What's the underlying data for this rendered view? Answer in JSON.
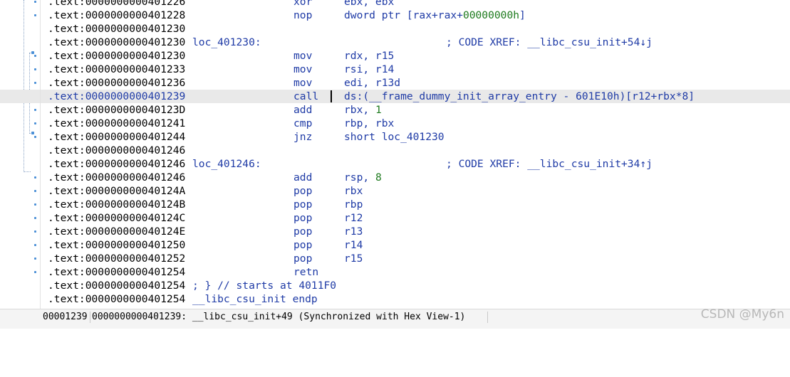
{
  "rows": [
    {
      "addr": ".text:0000000000401226",
      "label": "",
      "mnem": "xor",
      "op": "ebx, ebx",
      "comment": ""
    },
    {
      "addr": ".text:0000000000401228",
      "label": "",
      "mnem": "nop",
      "op": "dword ptr [rax+rax+",
      "op_num": "00000000h",
      "op_tail": "]",
      "comment": ""
    },
    {
      "addr": ".text:0000000000401230",
      "label": "",
      "mnem": "",
      "op": "",
      "comment": ""
    },
    {
      "addr": ".text:0000000000401230",
      "label": "loc_401230:",
      "mnem": "",
      "op": "",
      "comment": "; CODE XREF: __libc_csu_init+54↓j"
    },
    {
      "addr": ".text:0000000000401230",
      "label": "",
      "mnem": "mov",
      "op": "rdx, r15",
      "comment": ""
    },
    {
      "addr": ".text:0000000000401233",
      "label": "",
      "mnem": "mov",
      "op": "rsi, r14",
      "comment": ""
    },
    {
      "addr": ".text:0000000000401236",
      "label": "",
      "mnem": "mov",
      "op": "edi, r13d",
      "comment": ""
    },
    {
      "addr": ".text:0000000000401239",
      "label": "",
      "mnem": "call",
      "op": "ds:(__frame_dummy_init_array_entry - 601E10h)[r12+rbx*8]",
      "comment": "",
      "current": true
    },
    {
      "addr": ".text:000000000040123D",
      "label": "",
      "mnem": "add",
      "op": "rbx, ",
      "op_num": "1",
      "op_tail": "",
      "comment": ""
    },
    {
      "addr": ".text:0000000000401241",
      "label": "",
      "mnem": "cmp",
      "op": "rbp, rbx",
      "comment": ""
    },
    {
      "addr": ".text:0000000000401244",
      "label": "",
      "mnem": "jnz",
      "op": "short loc_401230",
      "comment": ""
    },
    {
      "addr": ".text:0000000000401246",
      "label": "",
      "mnem": "",
      "op": "",
      "comment": ""
    },
    {
      "addr": ".text:0000000000401246",
      "label": "loc_401246:",
      "mnem": "",
      "op": "",
      "comment": "; CODE XREF: __libc_csu_init+34↑j"
    },
    {
      "addr": ".text:0000000000401246",
      "label": "",
      "mnem": "add",
      "op": "rsp, ",
      "op_num": "8",
      "op_tail": "",
      "comment": ""
    },
    {
      "addr": ".text:000000000040124A",
      "label": "",
      "mnem": "pop",
      "op": "rbx",
      "comment": ""
    },
    {
      "addr": ".text:000000000040124B",
      "label": "",
      "mnem": "pop",
      "op": "rbp",
      "comment": ""
    },
    {
      "addr": ".text:000000000040124C",
      "label": "",
      "mnem": "pop",
      "op": "r12",
      "comment": ""
    },
    {
      "addr": ".text:000000000040124E",
      "label": "",
      "mnem": "pop",
      "op": "r13",
      "comment": ""
    },
    {
      "addr": ".text:0000000000401250",
      "label": "",
      "mnem": "pop",
      "op": "r14",
      "comment": ""
    },
    {
      "addr": ".text:0000000000401252",
      "label": "",
      "mnem": "pop",
      "op": "r15",
      "comment": ""
    },
    {
      "addr": ".text:0000000000401254",
      "label": "",
      "mnem": "retn",
      "op": "",
      "comment": ""
    },
    {
      "addr": ".text:0000000000401254",
      "label": "; } // starts at 4011F0",
      "mnem": "",
      "op": "",
      "comment": ""
    },
    {
      "addr": ".text:0000000000401254",
      "label": "__libc_csu_init endp",
      "mnem": "",
      "op": "",
      "comment": ""
    }
  ],
  "status": {
    "offset": "00001239",
    "location": "0000000000401239: __libc_csu_init+49 (Synchronized with Hex View-1)"
  },
  "watermark": "CSDN @My6n",
  "colors": {
    "address": "#000000",
    "code": "#1f3ba6",
    "number": "#1d7a1d",
    "current_line": "#e9e9e9",
    "flow_dot": "#4a8fd6"
  }
}
